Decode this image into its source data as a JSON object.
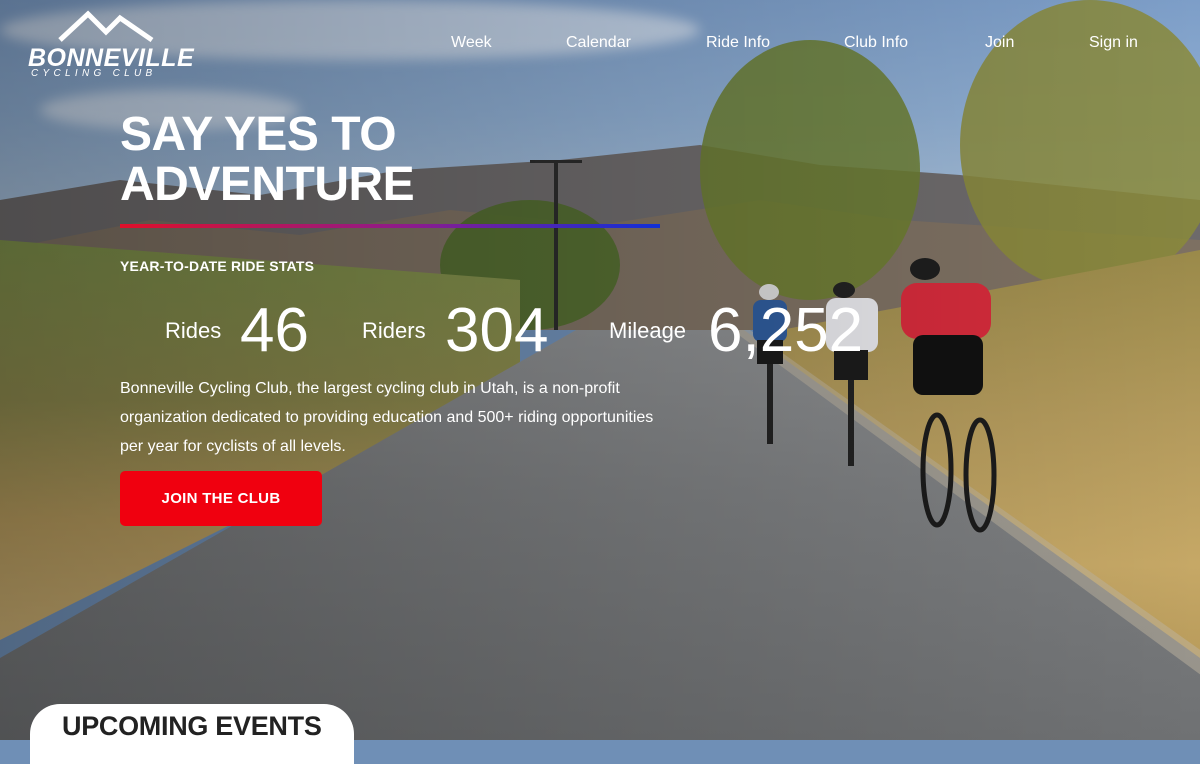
{
  "brand": {
    "name": "BONNEVILLE",
    "tagline": "CYCLING CLUB"
  },
  "nav": {
    "items": [
      {
        "label": "Week",
        "icon": ""
      },
      {
        "label": "Calendar",
        "icon": ""
      },
      {
        "label": "Ride Info",
        "icon": ""
      },
      {
        "label": "Club Info",
        "icon": ""
      },
      {
        "label": "Join",
        "icon": ""
      },
      {
        "label": "Sign in",
        "icon": ""
      }
    ]
  },
  "hero": {
    "headline_line1": "SAY YES TO",
    "headline_line2": "ADVENTURE",
    "stats_title": "YEAR-TO-DATE RIDE STATS",
    "stats": [
      {
        "label": "Rides",
        "value": "46"
      },
      {
        "label": "Riders",
        "value": "304"
      },
      {
        "label": "Mileage",
        "value": "6,252"
      }
    ],
    "description": "Bonneville Cycling Club, the largest cycling club in Utah, is a non-profit organization dedicated to providing education and 500+ riding opportunities per year for cyclists of all levels.",
    "cta_label": "JOIN THE CLUB"
  },
  "sections": {
    "events_title": "UPCOMING EVENTS"
  },
  "colors": {
    "cta": "#f0000f",
    "underline_start": "#e0102a",
    "underline_end": "#1030d8"
  }
}
